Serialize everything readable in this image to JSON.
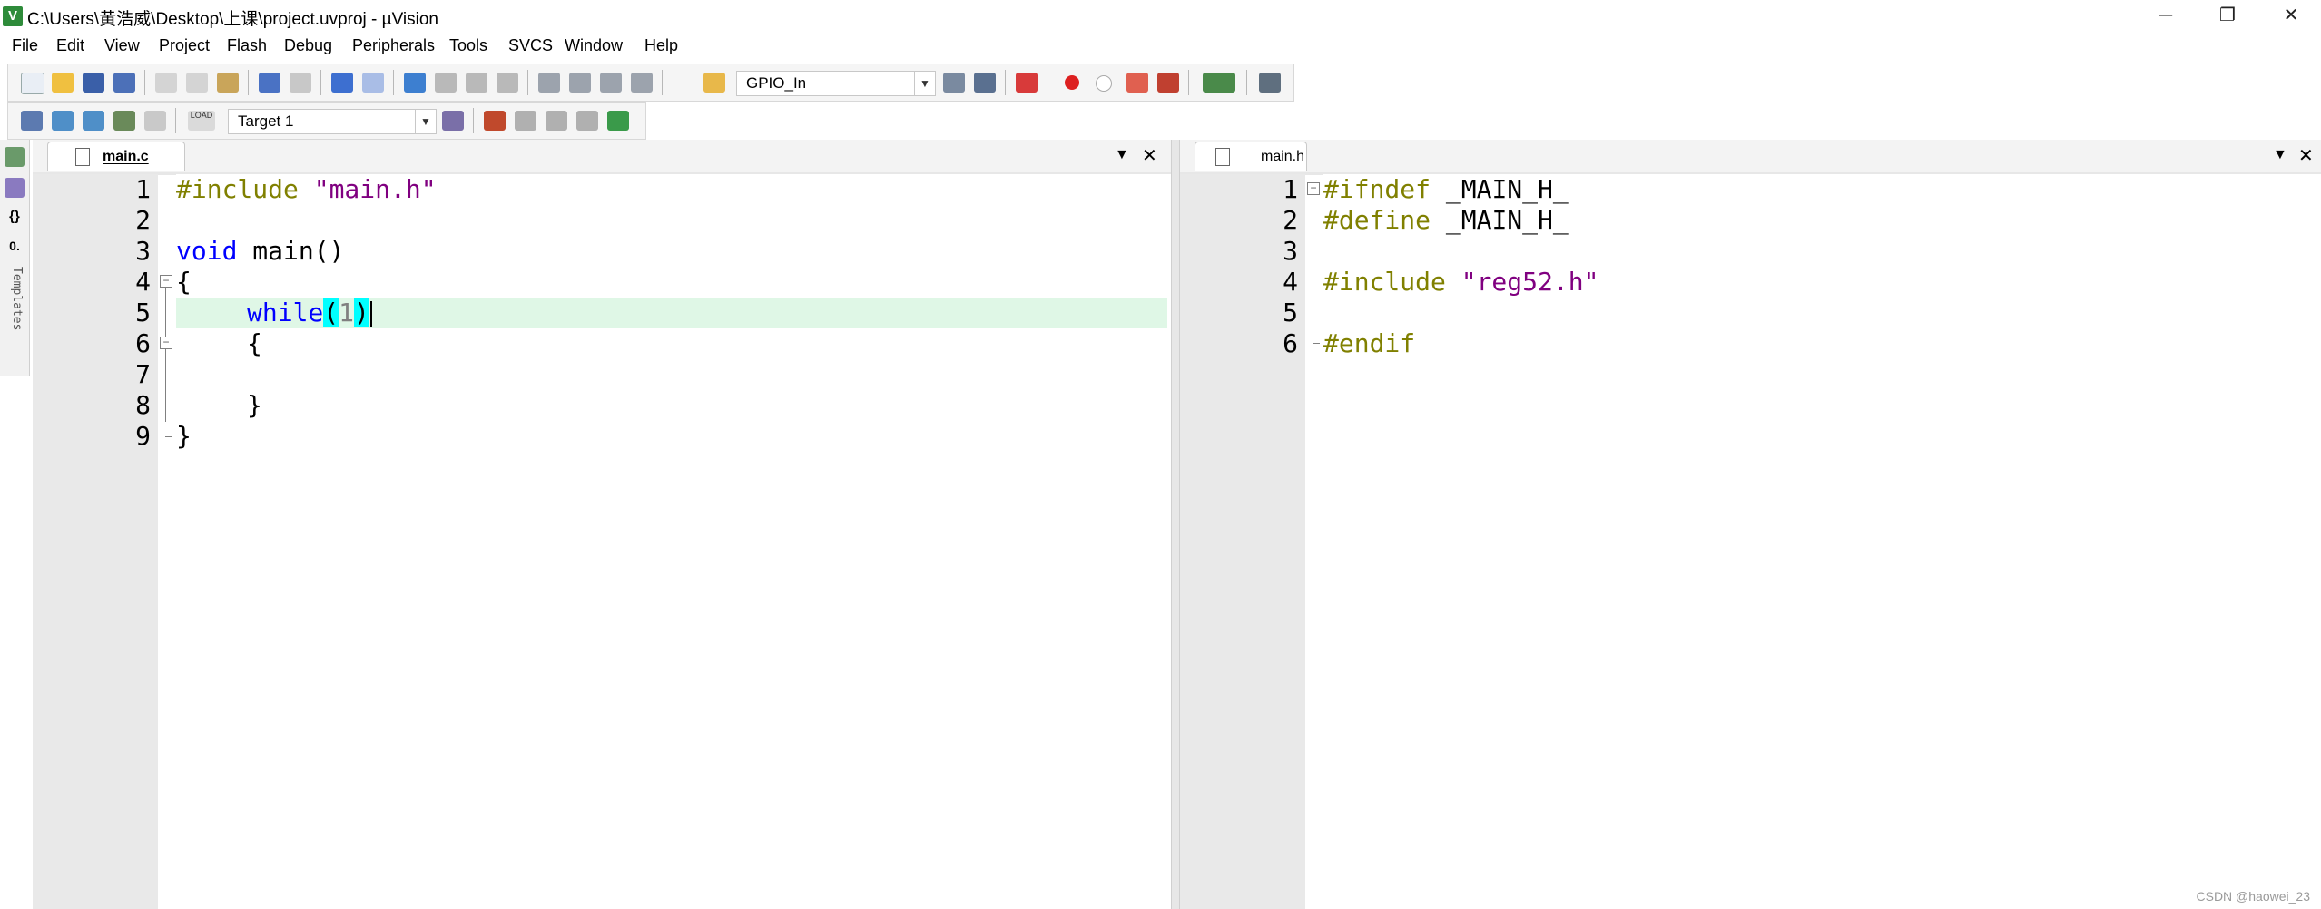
{
  "window": {
    "title": "C:\\Users\\黄浩威\\Desktop\\上课\\project.uvproj - µVision",
    "controls": {
      "minimize": "─",
      "restore": "❐",
      "close": "✕"
    }
  },
  "menu": [
    "File",
    "Edit",
    "View",
    "Project",
    "Flash",
    "Debug",
    "Peripherals",
    "Tools",
    "SVCS",
    "Window",
    "Help"
  ],
  "toolbar1": {
    "find_combo_value": "GPIO_In"
  },
  "toolbar2": {
    "target_combo_value": "Target 1",
    "load_label": "LOAD"
  },
  "sidepanel": {
    "templates_label": "Templates"
  },
  "left_editor": {
    "tab_label": "main.c",
    "line_numbers": [
      "1",
      "2",
      "3",
      "4",
      "5",
      "6",
      "7",
      "8",
      "9"
    ],
    "code": {
      "l1_directive": "#include ",
      "l1_string": "\"main.h\"",
      "l3_keyword": "void",
      "l3_rest": " main()",
      "l4": "{",
      "l5_keyword": "while",
      "l5_open": "(",
      "l5_arg": "1",
      "l5_close": ")",
      "l6": "{",
      "l8": "}",
      "l9": "}"
    }
  },
  "right_editor": {
    "tab_label": "main.h",
    "line_numbers": [
      "1",
      "2",
      "3",
      "4",
      "5",
      "6"
    ],
    "code": {
      "l1_directive": "#ifndef",
      "l1_rest": " _MAIN_H_",
      "l2_directive": "#define",
      "l2_rest": " _MAIN_H_",
      "l4_directive": "#include ",
      "l4_string": "\"reg52.h\"",
      "l6_directive": "#endif"
    }
  },
  "pane_controls": {
    "dropdown": "▼",
    "close": "✕"
  },
  "watermark": "CSDN @haowei_23",
  "colors": {
    "preprocessor": "#808000",
    "string": "#800080",
    "keyword": "#0000ff",
    "current_line": "#dff7e6",
    "brace_match": "#00ffff"
  }
}
